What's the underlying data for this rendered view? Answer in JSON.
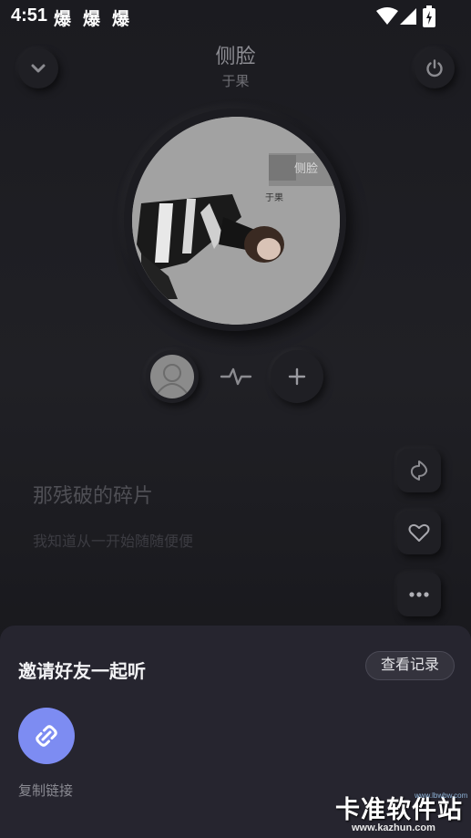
{
  "status_bar": {
    "time": "4:51",
    "notifications": [
      "爆",
      "爆",
      "爆"
    ]
  },
  "header": {
    "title": "侧脸",
    "artist": "于果",
    "collapse_icon": "chevron-down-icon",
    "power_icon": "power-icon"
  },
  "album": {
    "cover_text_1": "侧脸",
    "cover_text_2": "于果"
  },
  "controls": {
    "wave_icon": "pulse-icon",
    "add_icon": "plus-icon"
  },
  "lyrics": {
    "current": "那残破的碎片",
    "next": "我知道从一开始随随便便"
  },
  "side_actions": {
    "share_icon": "share-icon",
    "like_icon": "heart-icon",
    "more_icon": "more-icon"
  },
  "sheet": {
    "title": "邀请好友一起听",
    "history_label": "查看记录",
    "copy_link_label": "复制链接"
  },
  "watermark": {
    "text": "卡准软件站",
    "url": "www.kazhun.com",
    "small": "www.lbwbw.com"
  },
  "colors": {
    "accent": "#7d8cf2",
    "background": "#1b1b20",
    "sheet": "#26252f"
  }
}
